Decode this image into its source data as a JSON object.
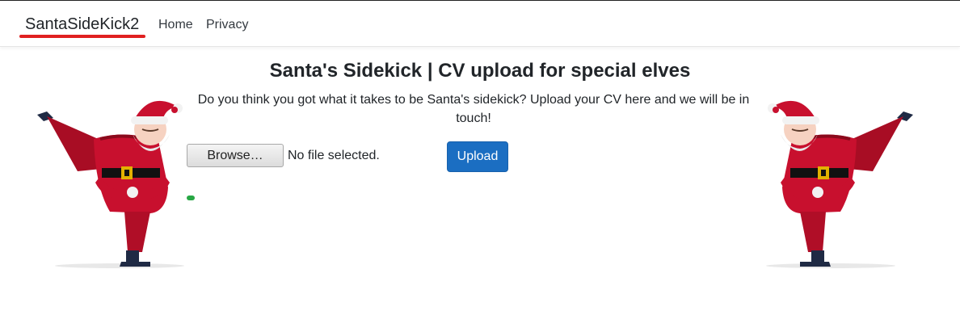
{
  "navbar": {
    "brand": "SantaSideKick2",
    "links": [
      "Home",
      "Privacy"
    ]
  },
  "main": {
    "title": "Santa's Sidekick | CV upload for special elves",
    "description": "Do you think you got what it takes to be Santa's sidekick? Upload your CV here and we will be in touch!",
    "browse_label": "Browse…",
    "file_status": "No file selected.",
    "upload_label": "Upload"
  },
  "colors": {
    "accent": "#1b6ec2",
    "brand_underline": "#e02020",
    "santa_red": "#c8102e",
    "status_green": "#28a745"
  },
  "images": {
    "left": "santa-kick-image",
    "right": "santa-kick-image"
  }
}
